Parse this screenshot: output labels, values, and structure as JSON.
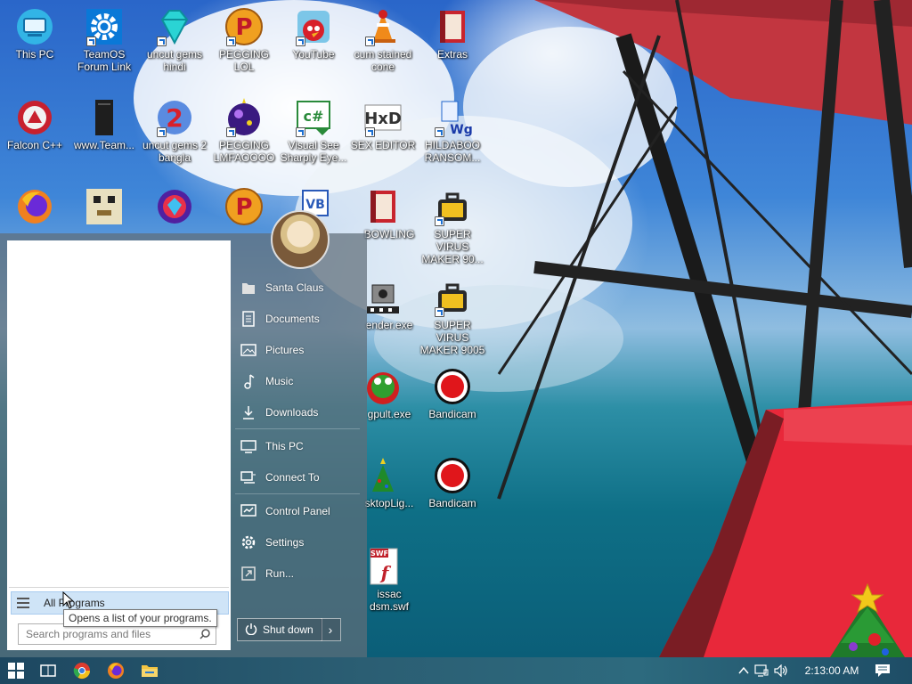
{
  "desktop": {
    "icons_row1": [
      {
        "label": "This PC"
      },
      {
        "label": "TeamOS Forum Link"
      },
      {
        "label": "uncut gems hindi"
      },
      {
        "label": "PEGGING LOL"
      },
      {
        "label": "YouTube"
      },
      {
        "label": "cum stained cone"
      },
      {
        "label": "Extras"
      }
    ],
    "icons_row2": [
      {
        "label": "Falcon C++"
      },
      {
        "label": "www.Team..."
      },
      {
        "label": "uncut gems 2 bangla"
      },
      {
        "label": "PEGGING LMFAOOOO"
      },
      {
        "label": "Visual See Sharply Eye..."
      },
      {
        "label": "SEX EDITOR"
      },
      {
        "label": "HILDABOO RANSOM..."
      }
    ],
    "icons_row3": [
      {
        "label": "BOWLING"
      },
      {
        "label": "SUPER VIRUS MAKER 90..."
      }
    ],
    "icons_row4": [
      {
        "label": "ender.exe"
      },
      {
        "label": "SUPER VIRUS MAKER 9005"
      }
    ],
    "icons_row5": [
      {
        "label": "gpult.exe"
      },
      {
        "label": "Bandicam"
      }
    ],
    "icons_row6": [
      {
        "label": "sktopLig..."
      },
      {
        "label": "Bandicam"
      }
    ],
    "icons_row7": [
      {
        "label": "issac dsm.swf"
      }
    ],
    "swf_badge": "SWF"
  },
  "start_menu": {
    "all_programs": "All Programs",
    "tooltip": "Opens a list of your programs.",
    "search_placeholder": "Search programs and files",
    "places": [
      {
        "label": "Santa Claus",
        "icon": "user-folder-icon"
      },
      {
        "label": "Documents",
        "icon": "documents-icon"
      },
      {
        "label": "Pictures",
        "icon": "pictures-icon"
      },
      {
        "label": "Music",
        "icon": "music-icon"
      },
      {
        "label": "Downloads",
        "icon": "downloads-icon"
      },
      {
        "label": "This PC",
        "icon": "computer-icon"
      },
      {
        "label": "Connect To",
        "icon": "connect-icon"
      },
      {
        "label": "Control Panel",
        "icon": "control-panel-icon"
      },
      {
        "label": "Settings",
        "icon": "settings-icon"
      },
      {
        "label": "Run...",
        "icon": "run-icon"
      }
    ],
    "shutdown_label": "Shut down",
    "shutdown_arrow": "›"
  },
  "taskbar": {
    "clock": "2:13:00 AM",
    "tray_chevron": "^"
  },
  "colors": {
    "accent": "#1b6ed0",
    "bandicam_red": "#e0161b",
    "wing_red": "#e8283a"
  }
}
